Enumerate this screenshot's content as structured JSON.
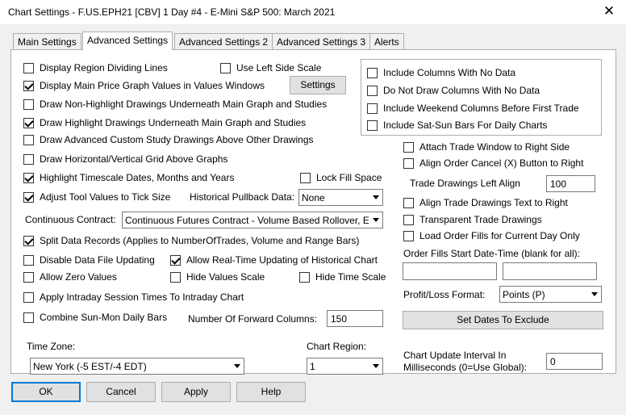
{
  "window": {
    "title": "Chart Settings - F.US.EPH21 [CBV]  1 Day   #4 - E-Mini S&P 500: March 2021",
    "close_glyph": "✕"
  },
  "tabs": [
    {
      "label": "Main Settings",
      "active": false
    },
    {
      "label": "Advanced Settings",
      "active": true
    },
    {
      "label": "Advanced Settings 2",
      "active": false
    },
    {
      "label": "Advanced Settings 3",
      "active": false
    },
    {
      "label": "Alerts",
      "active": false
    }
  ],
  "left": {
    "display_region_dividing_lines": {
      "label": "Display Region Dividing Lines",
      "checked": false
    },
    "use_left_side_scale": {
      "label": "Use Left Side Scale",
      "checked": false
    },
    "display_main_price_values": {
      "label": "Display Main Price Graph Values in Values Windows",
      "checked": true
    },
    "settings_button": "Settings",
    "draw_non_highlight_underneath": {
      "label": "Draw Non-Highlight Drawings Underneath Main Graph and Studies",
      "checked": false
    },
    "draw_highlight_underneath": {
      "label": "Draw Highlight Drawings Underneath Main Graph and Studies",
      "checked": true
    },
    "draw_advanced_custom_study": {
      "label": "Draw Advanced Custom Study Drawings Above Other Drawings",
      "checked": false
    },
    "draw_grid_above": {
      "label": "Draw Horizontal/Vertical Grid Above Graphs",
      "checked": false
    },
    "highlight_timescale_dates": {
      "label": "Highlight Timescale Dates, Months and Years",
      "checked": true
    },
    "lock_fill_space": {
      "label": "Lock Fill Space",
      "checked": false
    },
    "adjust_tool_values": {
      "label": "Adjust Tool Values to Tick Size",
      "checked": true
    },
    "historical_pullback_label": "Historical Pullback Data:",
    "historical_pullback_value": "None",
    "continuous_contract_label": "Continuous Contract:",
    "continuous_contract_value": "Continuous Futures Contract - Volume Based Rollover, E",
    "split_data_records": {
      "label": "Split Data Records (Applies to NumberOfTrades, Volume and Range Bars)",
      "checked": true
    },
    "disable_data_file_updating": {
      "label": "Disable Data File Updating",
      "checked": false
    },
    "allow_realtime_updating": {
      "label": "Allow Real-Time Updating of Historical Chart",
      "checked": true
    },
    "allow_zero_values": {
      "label": "Allow Zero Values",
      "checked": false
    },
    "hide_values_scale": {
      "label": "Hide Values Scale",
      "checked": false
    },
    "hide_time_scale": {
      "label": "Hide Time Scale",
      "checked": false
    },
    "apply_intraday_session": {
      "label": "Apply Intraday Session Times To Intraday Chart",
      "checked": false
    },
    "combine_sun_mon": {
      "label": "Combine Sun-Mon Daily Bars",
      "checked": false
    },
    "forward_columns_label": "Number Of Forward Columns:",
    "forward_columns_value": "150",
    "time_zone_label": "Time Zone:",
    "time_zone_value": "New York (-5 EST/-4 EDT)",
    "chart_region_label": "Chart Region:",
    "chart_region_value": "1"
  },
  "right": {
    "include_columns_no_data": {
      "label": "Include Columns With No Data",
      "checked": false
    },
    "do_not_draw_columns_no_data": {
      "label": "Do Not Draw Columns With No Data",
      "checked": false
    },
    "include_weekend_columns": {
      "label": "Include Weekend Columns Before First Trade",
      "checked": false
    },
    "include_sat_sun_bars": {
      "label": "Include Sat-Sun Bars For Daily Charts",
      "checked": false
    },
    "attach_trade_window": {
      "label": "Attach Trade Window to Right Side",
      "checked": false
    },
    "align_order_cancel": {
      "label": "Align Order Cancel (X) Button to Right",
      "checked": false
    },
    "trade_drawings_left_align_label": "Trade Drawings Left Align",
    "trade_drawings_left_align_value": "100",
    "align_trade_drawings_text": {
      "label": "Align Trade Drawings Text to Right",
      "checked": false
    },
    "transparent_trade_drawings": {
      "label": "Transparent Trade Drawings",
      "checked": false
    },
    "load_order_fills": {
      "label": "Load Order Fills for Current Day Only",
      "checked": false
    },
    "order_fills_start_label": "Order Fills Start Date-Time (blank for all):",
    "order_fills_start_date": "",
    "order_fills_start_time": "",
    "profit_loss_label": "Profit/Loss Format:",
    "profit_loss_value": "Points (P)",
    "set_dates_button": "Set Dates To Exclude",
    "update_interval_label_1": "Chart Update Interval In",
    "update_interval_label_2": "Milliseconds (0=Use Global):",
    "update_interval_value": "0"
  },
  "footer": {
    "ok": "OK",
    "cancel": "Cancel",
    "apply": "Apply",
    "help": "Help"
  }
}
